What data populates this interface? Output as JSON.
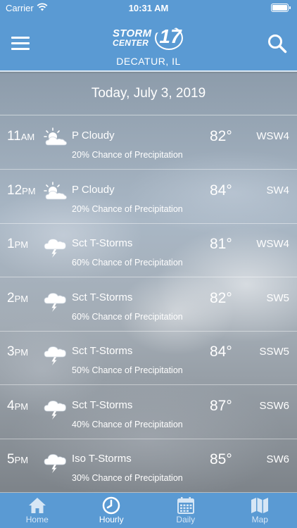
{
  "status_bar": {
    "carrier": "Carrier",
    "time": "10:31 AM"
  },
  "header": {
    "logo_line1": "STORM",
    "logo_line2": "CENTER",
    "logo_number": "17",
    "location": "DECATUR, IL"
  },
  "date": "Today, July 3, 2019",
  "forecast": [
    {
      "hour": "11",
      "ampm": "AM",
      "icon": "partly-cloudy-icon",
      "condition": "P Cloudy",
      "precip": "20% Chance of Precipitation",
      "temp": "82°",
      "wind": "WSW4"
    },
    {
      "hour": "12",
      "ampm": "PM",
      "icon": "partly-cloudy-icon",
      "condition": "P Cloudy",
      "precip": "20% Chance of Precipitation",
      "temp": "84°",
      "wind": "SW4"
    },
    {
      "hour": "1",
      "ampm": "PM",
      "icon": "thunderstorm-icon",
      "condition": "Sct T-Storms",
      "precip": "60% Chance of Precipitation",
      "temp": "81°",
      "wind": "WSW4"
    },
    {
      "hour": "2",
      "ampm": "PM",
      "icon": "thunderstorm-icon",
      "condition": "Sct T-Storms",
      "precip": "60% Chance of Precipitation",
      "temp": "82°",
      "wind": "SW5"
    },
    {
      "hour": "3",
      "ampm": "PM",
      "icon": "thunderstorm-icon",
      "condition": "Sct T-Storms",
      "precip": "50% Chance of Precipitation",
      "temp": "84°",
      "wind": "SSW5"
    },
    {
      "hour": "4",
      "ampm": "PM",
      "icon": "thunderstorm-icon",
      "condition": "Sct T-Storms",
      "precip": "40% Chance of Precipitation",
      "temp": "87°",
      "wind": "SSW6"
    },
    {
      "hour": "5",
      "ampm": "PM",
      "icon": "thunderstorm-icon",
      "condition": "Iso T-Storms",
      "precip": "30% Chance of Precipitation",
      "temp": "85°",
      "wind": "SW6"
    }
  ],
  "tabs": [
    {
      "label": "Home",
      "icon": "home-icon"
    },
    {
      "label": "Hourly",
      "icon": "clock-icon"
    },
    {
      "label": "Daily",
      "icon": "calendar-icon"
    },
    {
      "label": "Map",
      "icon": "map-icon"
    }
  ],
  "active_tab": "Hourly",
  "colors": {
    "brand_blue": "#5a9ad3",
    "tab_inactive": "#d6e6f5"
  }
}
